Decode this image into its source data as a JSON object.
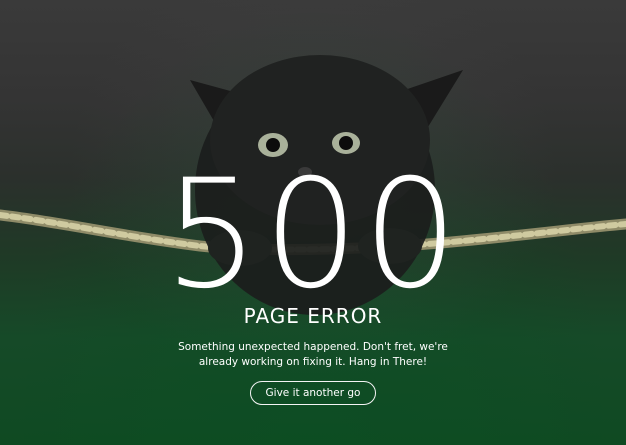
{
  "error": {
    "code": "500",
    "title": "PAGE ERROR",
    "message_line1": "Something unexpected happened. Don't fret, we're",
    "message_line2": "already working on fixing it. Hang in There!",
    "retry_label": "Give it another go"
  },
  "background": {
    "image": "black-kitten-hanging-on-rope",
    "top_color": "#3a3a3a",
    "bottom_color": "#0f4a22",
    "rope_color": "#b9b58c"
  }
}
